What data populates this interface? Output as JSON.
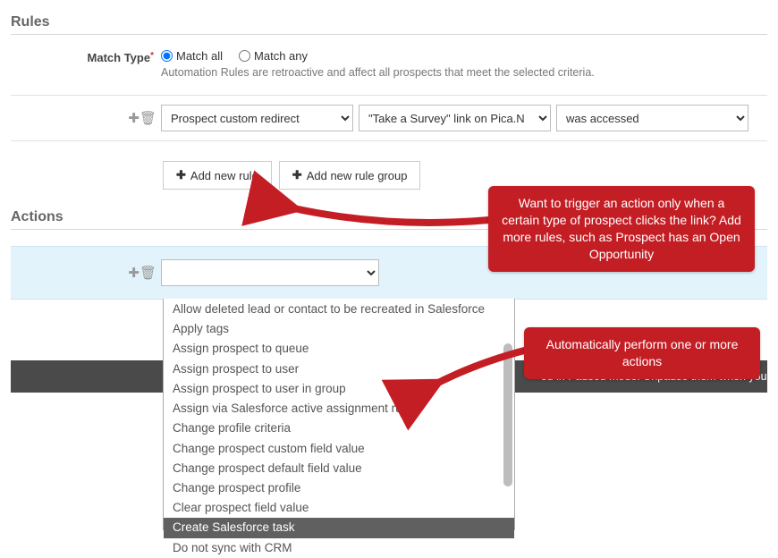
{
  "rules": {
    "header": "Rules",
    "match_type_label": "Match Type",
    "match_all": "Match all",
    "match_any": "Match any",
    "match_selected": "all",
    "helptext": "Automation Rules are retroactive and affect all prospects that meet the selected criteria.",
    "criteria": {
      "sel1": "Prospect custom redirect",
      "sel2": "\"Take a Survey\" link on Pica.N",
      "sel3": "was accessed"
    },
    "add_rule_btn": "Add new rule",
    "add_group_btn": "Add new rule group"
  },
  "actions": {
    "header": "Actions",
    "selected": "",
    "options": [
      "Allow deleted lead or contact to be recreated in Salesforce",
      "Apply tags",
      "Assign prospect to queue",
      "Assign prospect to user",
      "Assign prospect to user in group",
      "Assign via Salesforce active assignment rule",
      "Change profile criteria",
      "Change prospect custom field value",
      "Change prospect default field value",
      "Change prospect profile",
      "Clear prospect field value",
      "Create Salesforce task",
      "Do not sync with CRM"
    ],
    "highlighted_index": 11
  },
  "banner": "ed in Paused mode. Unpause them when you a",
  "callouts": {
    "c1": "Want to trigger an action only when a certain type of prospect clicks the link? Add more rules, such as Prospect has an Open Opportunity",
    "c2": "Automatically perform one or more actions"
  },
  "colors": {
    "accent_red": "#c41e25",
    "info_bg": "#e3f3fb",
    "primary_blue": "#0070d2"
  }
}
